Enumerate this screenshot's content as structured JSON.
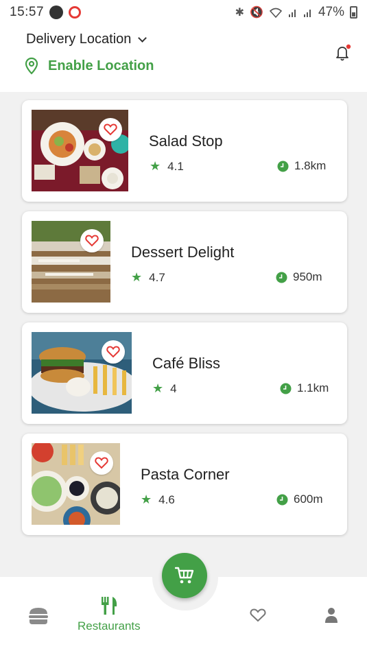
{
  "status_bar": {
    "time": "15:57",
    "battery_percent": "47%",
    "icons": [
      "app-a-icon",
      "app-o-icon",
      "bluetooth-icon",
      "mute-icon",
      "wifi-icon",
      "signal-icon",
      "signal-icon",
      "battery-icon"
    ]
  },
  "header": {
    "delivery_label": "Delivery Location",
    "location_action": "Enable Location",
    "notification_dot_color": "#e53935"
  },
  "colors": {
    "accent": "#43a047",
    "heart": "#e53935"
  },
  "restaurants": [
    {
      "name": "Salad Stop",
      "rating": "4.1",
      "distance": "1.8km"
    },
    {
      "name": "Dessert Delight",
      "rating": "4.7",
      "distance": "950m"
    },
    {
      "name": "Café Bliss",
      "rating": "4",
      "distance": "1.1km"
    },
    {
      "name": "Pasta Corner",
      "rating": "4.6",
      "distance": "600m"
    }
  ],
  "bottom_nav": {
    "items": [
      {
        "icon": "burger-icon",
        "label": ""
      },
      {
        "icon": "fork-knife-icon",
        "label": "Restaurants",
        "active": true
      },
      {
        "icon": "heart-icon",
        "label": ""
      },
      {
        "icon": "person-icon",
        "label": ""
      }
    ],
    "fab_icon": "cart-icon"
  }
}
